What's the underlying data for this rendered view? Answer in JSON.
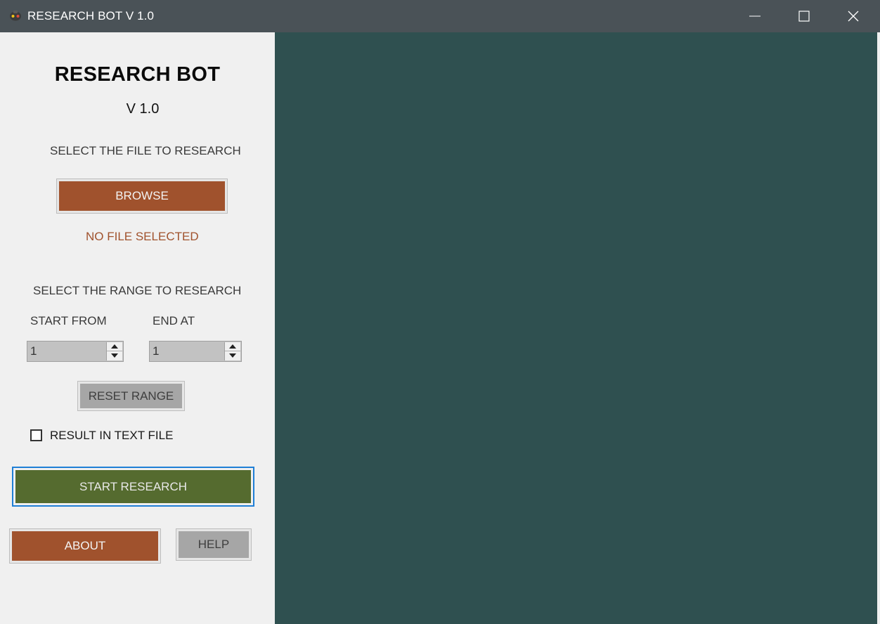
{
  "window": {
    "title": "RESEARCH BOT V 1.0",
    "icon": "app-icon",
    "controls": [
      "minimize-icon",
      "maximize-icon",
      "close-icon"
    ]
  },
  "sidebar": {
    "app_title": "RESEARCH BOT",
    "version": "V 1.0",
    "select_file_label": "SELECT THE FILE TO RESEARCH",
    "browse_label": "BROWSE",
    "file_status": "NO FILE SELECTED",
    "range_label": "SELECT THE RANGE TO RESEARCH",
    "start_label": "START FROM",
    "end_label": "END AT",
    "start_value": "1",
    "end_value": "1",
    "reset_label": "RESET RANGE",
    "checkbox_label": "RESULT IN TEXT FILE",
    "checkbox_checked": false,
    "start_research_label": "START RESEARCH",
    "about_label": "ABOUT",
    "help_label": "HELP"
  },
  "colors": {
    "titlebar": "#4a5257",
    "sidebar_bg": "#f0f0f0",
    "content_bg": "#2f5050",
    "sienna_button": "#a0522d",
    "olive_button": "#556b2f",
    "gray_button": "#a6a6a6",
    "focus_border": "#1f7fd6"
  }
}
